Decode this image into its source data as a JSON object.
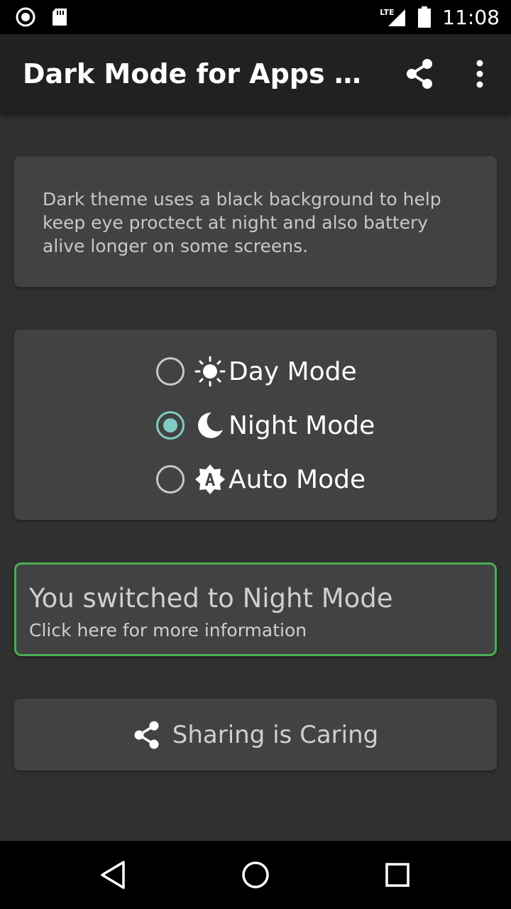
{
  "status_bar": {
    "network_label": "LTE",
    "time": "11:08"
  },
  "app_bar": {
    "title": "Dark Mode for Apps Night…",
    "share_icon": "share-icon",
    "more_icon": "more-vert-icon"
  },
  "info_card": {
    "text": "Dark theme uses a black background to help keep eye proctect at night and also battery alive longer on some screens."
  },
  "modes": {
    "selected": "night",
    "items": [
      {
        "id": "day",
        "label": "Day Mode",
        "icon": "sun-icon",
        "checked": false
      },
      {
        "id": "night",
        "label": "Night Mode",
        "icon": "moon-icon",
        "checked": true
      },
      {
        "id": "auto",
        "label": "Auto Mode",
        "icon": "auto-brightness-icon",
        "checked": false
      }
    ]
  },
  "notice": {
    "title": "You switched to Night Mode",
    "subtitle": "Click here for more information"
  },
  "share_button": {
    "label": "Sharing is Caring",
    "icon": "share-icon"
  },
  "nav_bar": {
    "back_icon": "back-triangle-icon",
    "home_icon": "home-circle-icon",
    "recents_icon": "recents-square-icon"
  },
  "colors": {
    "background": "#303030",
    "app_bar": "#212121",
    "card": "#424242",
    "radio_accent": "#80cbc4",
    "notice_border": "#4caf50"
  }
}
